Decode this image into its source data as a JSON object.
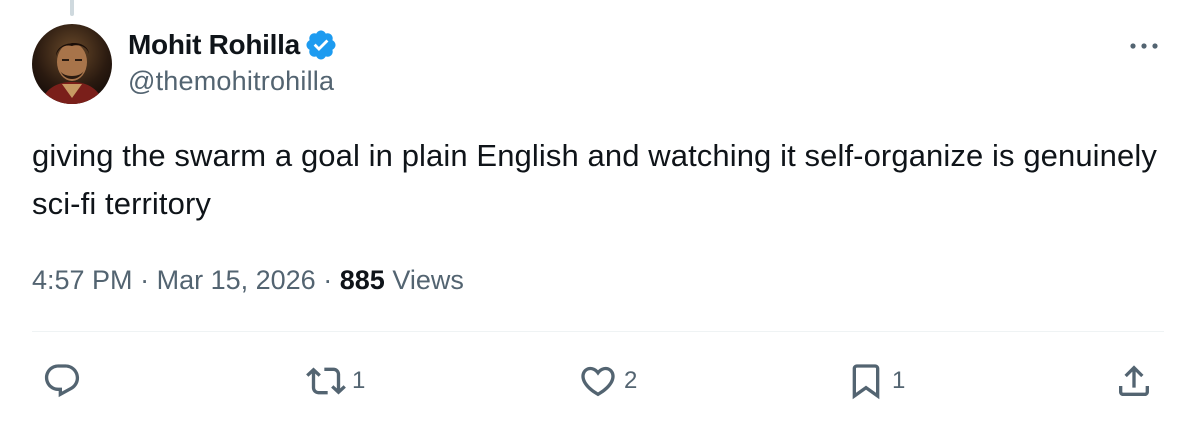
{
  "author": {
    "display_name": "Mohit Rohilla",
    "handle": "@themohitrohilla",
    "verified": true
  },
  "tweet": {
    "text": "giving the swarm a goal in plain English and watching it self-organize is genuinely sci-fi territory",
    "time": "4:57 PM",
    "separator": "·",
    "date": "Mar 15, 2026",
    "views_count": "885",
    "views_label": "Views"
  },
  "actions": {
    "replies": "",
    "retweets": "1",
    "likes": "2",
    "bookmarks": "1"
  },
  "colors": {
    "text_primary": "#0f1419",
    "text_secondary": "#536471",
    "verified_blue": "#1d9bf0",
    "divider": "#eff3f4"
  },
  "icons": {
    "more": "more-horizontal-icon",
    "reply": "reply-icon",
    "retweet": "retweet-icon",
    "like": "heart-icon",
    "bookmark": "bookmark-icon",
    "share": "share-icon",
    "verified": "verified-badge-icon"
  }
}
